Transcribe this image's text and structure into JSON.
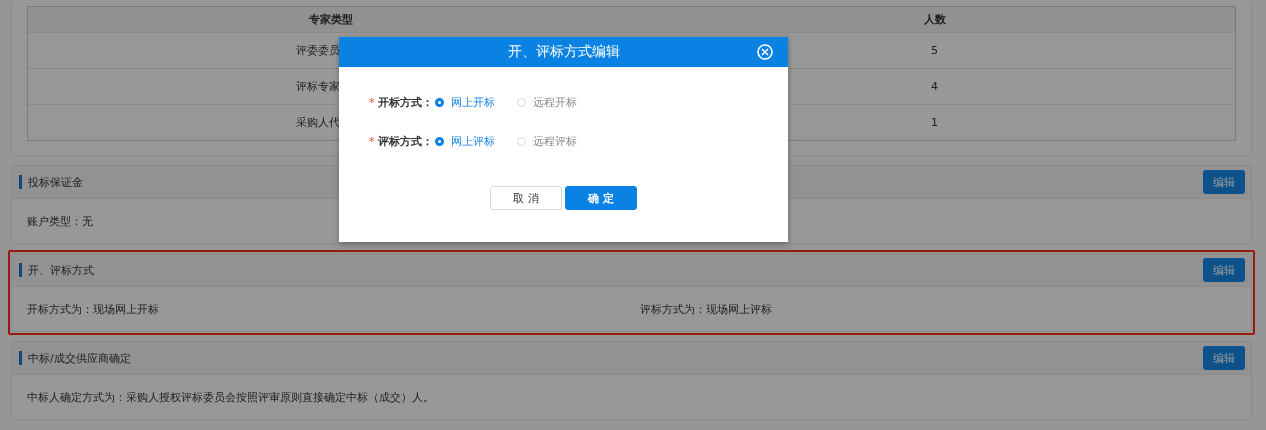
{
  "table": {
    "columns": [
      "专家类型",
      "人数"
    ],
    "rows": [
      {
        "type": "评委委员",
        "count": "5"
      },
      {
        "type": "评标专家",
        "count": "4"
      },
      {
        "type": "采购人代",
        "count": "1"
      }
    ]
  },
  "sections": [
    {
      "title": "投标保证金",
      "button": "编辑",
      "highlighted": false,
      "fields": [
        "账户类型：无"
      ]
    },
    {
      "title": "开、评标方式",
      "button": "编辑",
      "highlighted": true,
      "fields": [
        "开标方式为：现场网上开标",
        "评标方式为：现场网上评标"
      ]
    },
    {
      "title": "中标/成交供应商确定",
      "button": "编辑",
      "highlighted": false,
      "fields": [
        "中标人确定方式为：采购人授权评标委员会按照评审原则直接确定中标（成交）人。"
      ]
    }
  ],
  "dialog": {
    "title": "开、评标方式编辑",
    "fields": [
      {
        "label": "开标方式：",
        "required": true,
        "options": [
          {
            "label": "网上开标",
            "selected": true
          },
          {
            "label": "远程开标",
            "selected": false
          }
        ]
      },
      {
        "label": "评标方式：",
        "required": true,
        "options": [
          {
            "label": "网上评标",
            "selected": true
          },
          {
            "label": "远程评标",
            "selected": false
          }
        ]
      }
    ],
    "required_mark": "*",
    "buttons": [
      {
        "label": "取 消",
        "kind": "default"
      },
      {
        "label": "确 定",
        "kind": "primary"
      }
    ]
  }
}
